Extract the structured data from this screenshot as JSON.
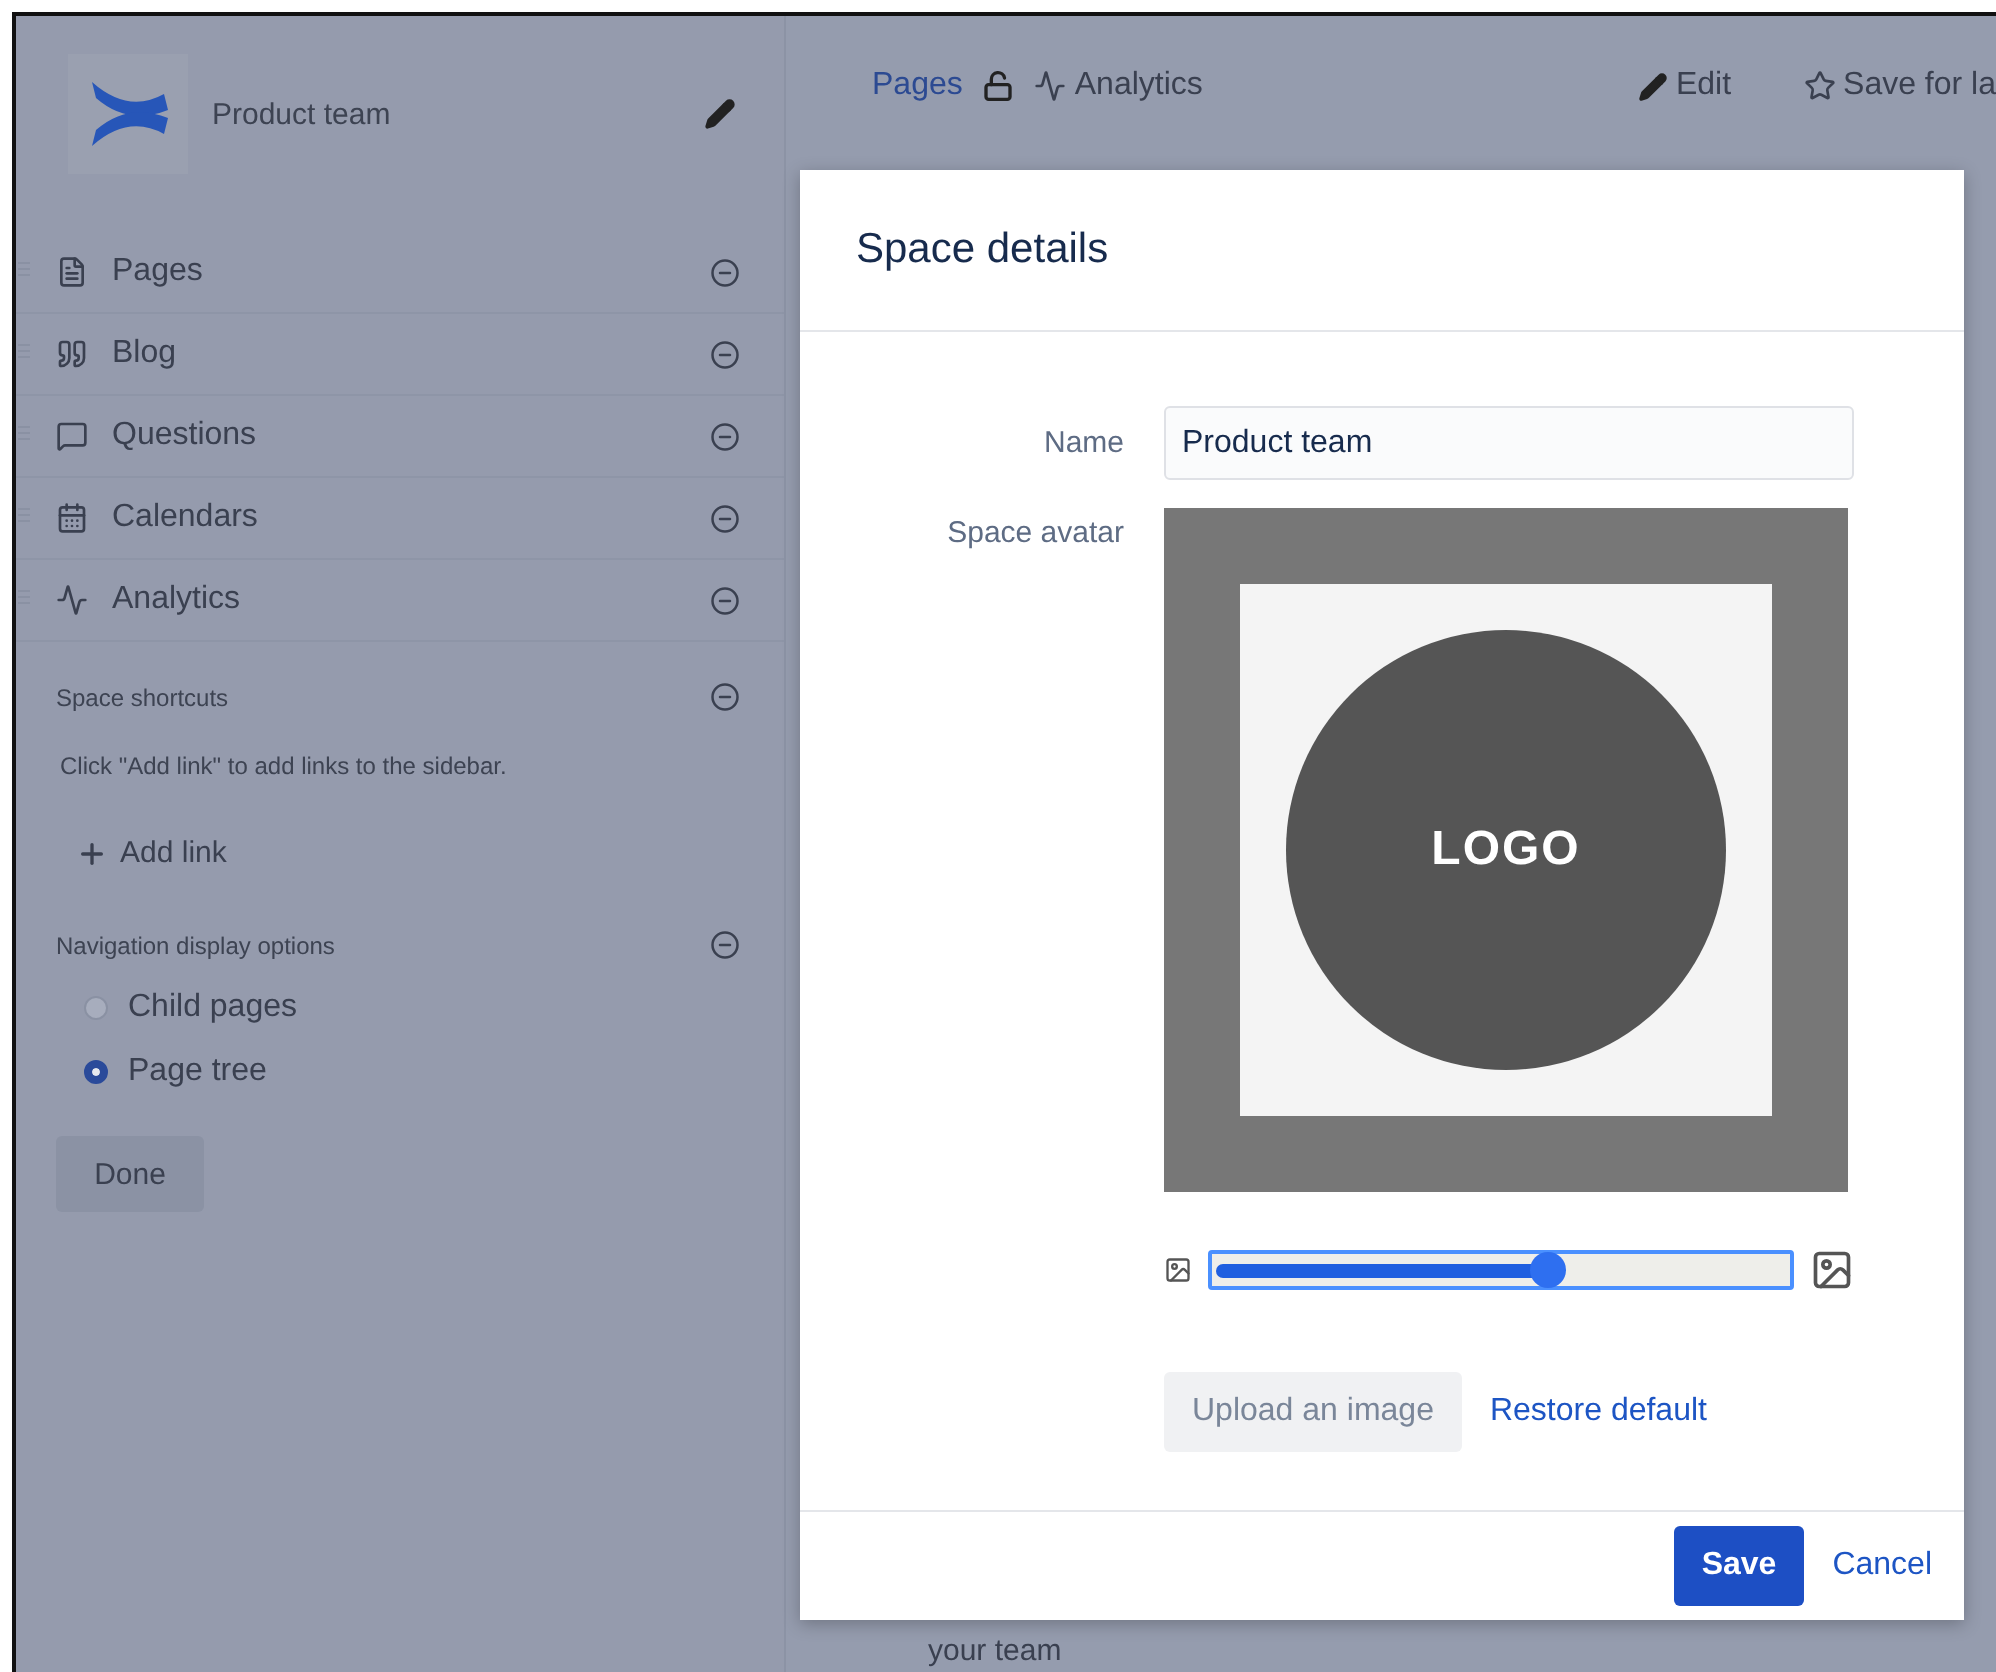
{
  "space": {
    "name": "Product team"
  },
  "sidebar": {
    "items": [
      {
        "kind": "pages",
        "label": "Pages"
      },
      {
        "kind": "blog",
        "label": "Blog"
      },
      {
        "kind": "questions",
        "label": "Questions"
      },
      {
        "kind": "calendars",
        "label": "Calendars"
      },
      {
        "kind": "analytics",
        "label": "Analytics"
      }
    ],
    "shortcuts": {
      "title": "Space shortcuts",
      "hint": "Click \"Add link\" to add links to the sidebar.",
      "add_link": "Add link"
    },
    "navigation": {
      "title": "Navigation display options",
      "options": [
        {
          "label": "Child pages",
          "selected": false
        },
        {
          "label": "Page tree",
          "selected": true
        }
      ],
      "done": "Done"
    }
  },
  "topbar": {
    "breadcrumb": "Pages",
    "analytics": "Analytics",
    "edit": "Edit",
    "save": "Save for la"
  },
  "background_text": "your team",
  "dialog": {
    "title": "Space details",
    "name_label": "Name",
    "name_value": "Product team",
    "avatar_label": "Space avatar",
    "logo_text": "LOGO",
    "zoom": {
      "level": 0.58
    },
    "upload": "Upload an image",
    "restore": "Restore default",
    "save": "Save",
    "cancel": "Cancel"
  }
}
